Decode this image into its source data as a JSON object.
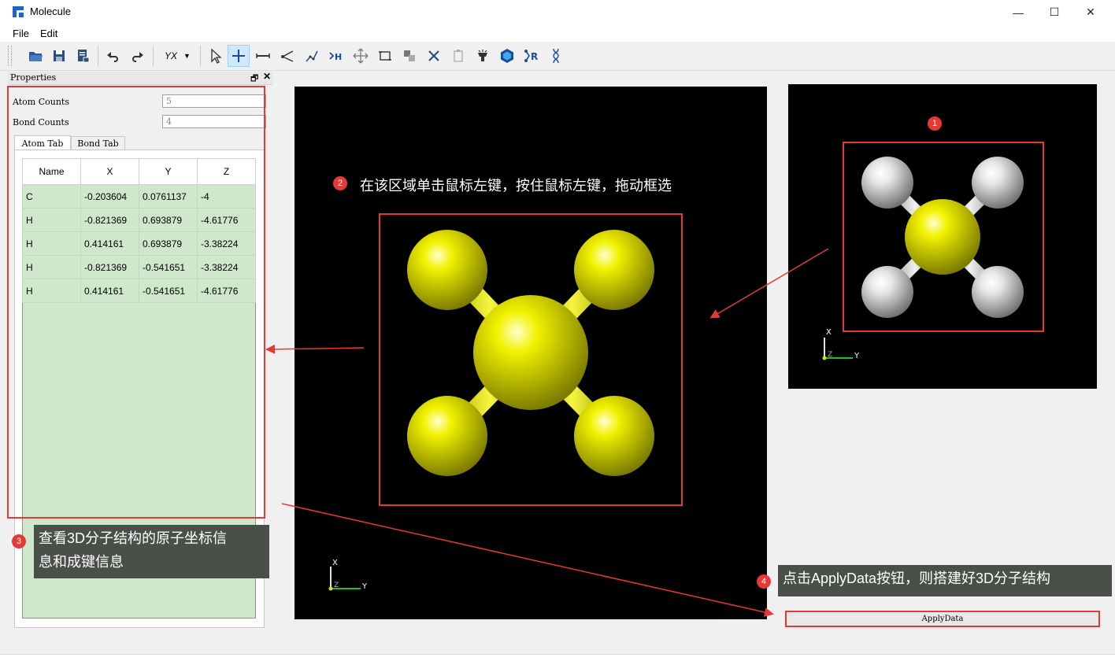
{
  "window": {
    "title": "Molecule",
    "minimize": "—",
    "maximize": "☐",
    "close": "✕"
  },
  "menu": {
    "file": "File",
    "edit": "Edit"
  },
  "toolbar": {
    "projection_label": "YX"
  },
  "properties": {
    "title": "Properties",
    "atom_counts_label": "Atom Counts",
    "atom_counts_value": "5",
    "bond_counts_label": "Bond Counts",
    "bond_counts_value": "4",
    "tabs": [
      "Atom Tab",
      "Bond Tab"
    ],
    "table": {
      "headers": [
        "Name",
        "X",
        "Y",
        "Z"
      ],
      "rows": [
        [
          "C",
          "-0.203604",
          "0.0761137",
          "-4"
        ],
        [
          "H",
          "-0.821369",
          "0.693879",
          "-4.61776"
        ],
        [
          "H",
          "0.414161",
          "0.693879",
          "-3.38224"
        ],
        [
          "H",
          "-0.821369",
          "-0.541651",
          "-3.38224"
        ],
        [
          "H",
          "0.414161",
          "-0.541651",
          "-4.61776"
        ]
      ]
    }
  },
  "annotations": {
    "n1": "1",
    "n2": "2",
    "n3": "3",
    "n4": "4",
    "text2": "在该区域单击鼠标左键，按住鼠标左键，拖动框选",
    "text3_line1": "查看3D分子结构的原子坐标信",
    "text3_line2": "息和成键信息",
    "text4": "点击ApplyData按钮，则搭建好3D分子结构"
  },
  "axes": {
    "x": "X",
    "y": "Y",
    "z": "Z"
  },
  "apply_button": "ApplyData",
  "colors": {
    "accent": "#e53935",
    "table_bg": "#cfe8cc",
    "atom_yellow": "#f2f200",
    "atom_white": "#f0f0f0"
  }
}
